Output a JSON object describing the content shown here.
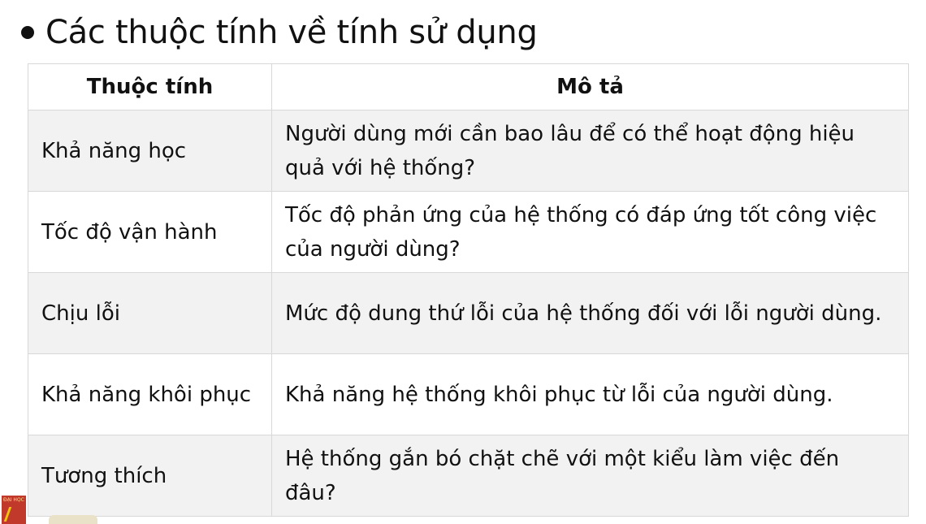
{
  "slide": {
    "title": "Các thuộc tính về tính sử dụng"
  },
  "table": {
    "headers": [
      "Thuộc tính",
      "Mô tả"
    ],
    "rows": [
      {
        "attribute": "Khả năng học",
        "description": "Người dùng mới cần bao lâu để có thể hoạt động hiệu quả với hệ thống?"
      },
      {
        "attribute": "Tốc độ vận hành",
        "description": "Tốc độ phản ứng của hệ thống có đáp ứng tốt công việc của người dùng?"
      },
      {
        "attribute": "Chịu lỗi",
        "description": "Mức độ dung thứ lỗi của hệ thống đối với lỗi người dùng."
      },
      {
        "attribute": "Khả năng khôi phục",
        "description": "Khả năng hệ thống khôi phục từ lỗi của người dùng."
      },
      {
        "attribute": "Tương thích",
        "description": "Hệ thống gắn bó chặt chẽ với một kiểu làm việc đến đâu?"
      }
    ]
  },
  "logo": {
    "text": "ĐẠI HỌC",
    "color": "#c0392b"
  },
  "colors": {
    "row_stripe": "#f2f2f2",
    "border": "#d8d8d8"
  }
}
